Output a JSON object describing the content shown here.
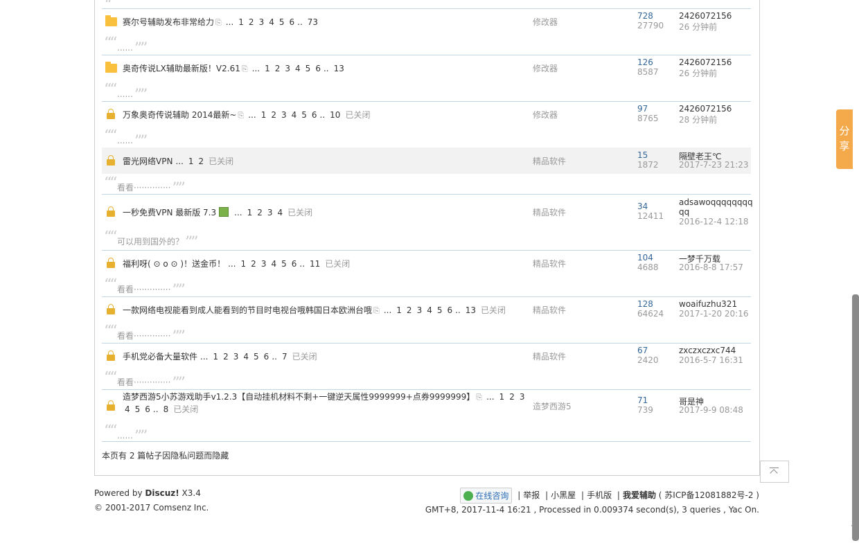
{
  "threads": [
    {
      "icon": "folder",
      "title": "赛尔号辅助发布非常给力",
      "attach": true,
      "image": false,
      "pages": [
        "1",
        "2",
        "3",
        "4",
        "5",
        "6"
      ],
      "last_page": "73",
      "closed": false,
      "forum": "修改器",
      "replies": "728",
      "views": "27790",
      "author": "2426072156",
      "time": "26 分钟前",
      "reply_text": "......",
      "highlight": false
    },
    {
      "icon": "folder",
      "title": "奥奇传说LX辅助最新版！V2.61",
      "attach": true,
      "image": false,
      "pages": [
        "1",
        "2",
        "3",
        "4",
        "5",
        "6"
      ],
      "last_page": "13",
      "closed": false,
      "forum": "修改器",
      "replies": "126",
      "views": "8587",
      "author": "2426072156",
      "time": "26 分钟前",
      "reply_text": "......",
      "highlight": false
    },
    {
      "icon": "lock",
      "title": "万象奥奇传说辅助 2014最新~",
      "attach": true,
      "image": false,
      "pages": [
        "1",
        "2",
        "3",
        "4",
        "5",
        "6"
      ],
      "last_page": "10",
      "closed": true,
      "forum": "修改器",
      "replies": "97",
      "views": "8765",
      "author": "2426072156",
      "time": "28 分钟前",
      "reply_text": "......",
      "highlight": false
    },
    {
      "icon": "lock",
      "title": "雷光网络VPN",
      "attach": false,
      "image": false,
      "pages": [
        "1",
        "2"
      ],
      "last_page": "",
      "closed": true,
      "forum": "精品软件",
      "replies": "15",
      "views": "1872",
      "author": "隔壁老王℃",
      "time": "2017-7-23 21:23",
      "reply_text": "看看··············",
      "highlight": true
    },
    {
      "icon": "lock",
      "title": "一秒免费VPN 最新版 7.3",
      "attach": false,
      "image": true,
      "pages": [
        "1",
        "2",
        "3",
        "4"
      ],
      "last_page": "",
      "closed": true,
      "forum": "精品软件",
      "replies": "34",
      "views": "12411",
      "author": "adsawoqqqqqqqq",
      "author_line2": "qq",
      "time": "2016-12-4 12:18",
      "reply_text": "可以用到国外的？",
      "highlight": false
    },
    {
      "icon": "lock",
      "title": "福利呀( ⊙ o ⊙ )！送金币！",
      "attach": false,
      "image": false,
      "pages": [
        "1",
        "2",
        "3",
        "4",
        "5",
        "6"
      ],
      "last_page": "11",
      "closed": true,
      "forum": "精品软件",
      "replies": "104",
      "views": "4688",
      "author": "一梦千万载",
      "time": "2016-8-8 17:57",
      "reply_text": "看看··············",
      "highlight": false
    },
    {
      "icon": "lock",
      "title": "一款网络电视能看到成人能看到的节目时电视台哦韩国日本欧洲台哦",
      "attach": true,
      "image": false,
      "pages": [
        "1",
        "2",
        "3",
        "4",
        "5",
        "6"
      ],
      "last_page": "13",
      "closed": true,
      "forum": "精品软件",
      "replies": "128",
      "views": "64624",
      "author": "woaifuzhu321",
      "time": "2017-1-20 20:16",
      "reply_text": "看看··············",
      "highlight": false
    },
    {
      "icon": "lock",
      "title": "手机党必备大量软件",
      "attach": false,
      "image": false,
      "pages": [
        "1",
        "2",
        "3",
        "4",
        "5",
        "6"
      ],
      "last_page": "7",
      "closed": true,
      "forum": "精品软件",
      "replies": "67",
      "views": "2420",
      "author": "zxczxczxc744",
      "time": "2016-5-7 16:31",
      "reply_text": "看看··············",
      "highlight": false
    },
    {
      "icon": "lock",
      "title": "造梦西游5小苏游戏助手v1.2.3【自动挂机材料不剩+一键逆天属性9999999+点券9999999】",
      "attach": true,
      "image": false,
      "pages": [
        "1",
        "2",
        "3"
      ],
      "pages_line2": [
        "4",
        "5",
        "6"
      ],
      "last_page": "8",
      "closed": true,
      "forum": "造梦西游5",
      "replies": "71",
      "views": "739",
      "author": "哥是神",
      "time": "2017-9-9 08:48",
      "reply_text": "......",
      "highlight": false
    }
  ],
  "labels": {
    "ellipsis": "...",
    "dotdot": "..",
    "closed": "已关闭",
    "top_reply": "......"
  },
  "hidden_note": "本页有 2 篇帖子因隐私问题而隐藏",
  "footer": {
    "powered_prefix": "Powered by ",
    "powered_brand": "Discuz!",
    "powered_version": " X3.4",
    "copyright": "© 2001-2017 Comsenz Inc.",
    "consult": "在线咨询",
    "links": [
      "举报",
      "小黑屋",
      "手机版"
    ],
    "site_name": "我爱辅助",
    "icp": "( 苏ICP备12081882号-2 )",
    "status": "GMT+8, 2017-11-4 16:21 , Processed in 0.009374 second(s), 3 queries , Yac On."
  },
  "share_label": "分享",
  "colors": {
    "link_blue": "#336699",
    "muted": "#999999",
    "share_orange": "#f4a94a",
    "border": "#c2d5e3"
  }
}
